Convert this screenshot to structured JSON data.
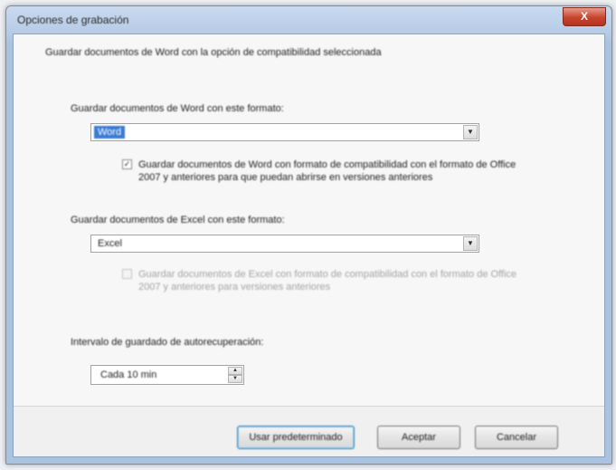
{
  "window": {
    "title": "Opciones de grabación",
    "close_label": "X"
  },
  "heading": "Guardar documentos de Word con la opción de compatibilidad seleccionada",
  "section1": {
    "label": "Guardar documentos de Word con este formato:",
    "combo_value": "Word",
    "checkbox_checked": true,
    "checkbox_label": "Guardar documentos de Word con formato de compatibilidad con el formato de Office 2007 y anteriores para que puedan abrirse en versiones anteriores"
  },
  "section2": {
    "label": "Guardar documentos de Excel con este formato:",
    "combo_value": "Excel",
    "checkbox_checked": false,
    "checkbox_label": "Guardar documentos de Excel con formato de compatibilidad con el formato de Office 2007 y anteriores para versiones anteriores"
  },
  "section3": {
    "label": "Intervalo de guardado de autorecuperación:",
    "spinner_value": "Cada 10 min"
  },
  "buttons": {
    "default": "Usar predeterminado",
    "accept": "Aceptar",
    "cancel": "Cancelar"
  }
}
